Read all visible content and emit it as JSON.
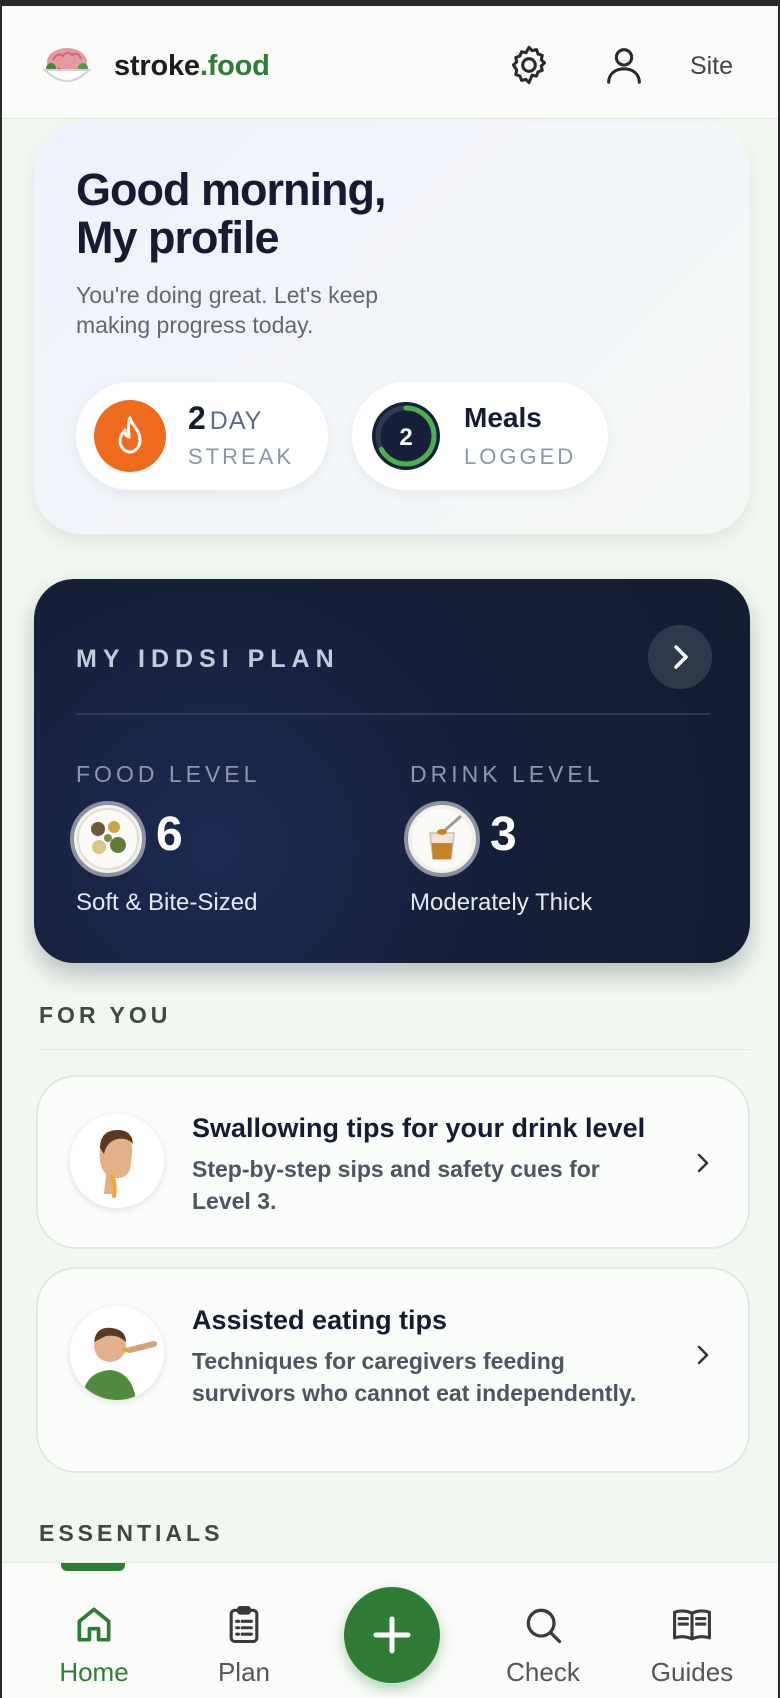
{
  "header": {
    "brand_name": "stroke",
    "brand_tld": ".food",
    "settings_icon": "gear-icon",
    "profile_icon": "user-icon",
    "site_label": "Site"
  },
  "greeting": {
    "title_line1": "Good morning,",
    "title_line2": "My profile",
    "subtitle": "You're doing great. Let's keep making progress today.",
    "streak": {
      "value": "2",
      "unit": "DAY",
      "label": "STREAK"
    },
    "meals": {
      "value": "2",
      "title": "Meals",
      "label": "LOGGED",
      "progress": 0.67
    }
  },
  "iddsi": {
    "title": "MY IDDSI PLAN",
    "food": {
      "heading": "FOOD LEVEL",
      "level": "6",
      "description": "Soft & Bite-Sized"
    },
    "drink": {
      "heading": "DRINK LEVEL",
      "level": "3",
      "description": "Moderately Thick"
    }
  },
  "for_you": {
    "heading": "FOR YOU",
    "tips": [
      {
        "title": "Swallowing tips for your drink level",
        "text": "Step-by-step sips and safety cues for Level 3."
      },
      {
        "title": "Assisted eating tips",
        "text": "Techniques for caregivers feeding survivors who cannot eat independently."
      }
    ]
  },
  "essentials": {
    "heading": "ESSENTIALS"
  },
  "nav": {
    "items": [
      {
        "label": "Home",
        "icon": "home-icon",
        "active": true
      },
      {
        "label": "Plan",
        "icon": "clipboard-icon",
        "active": false
      },
      {
        "label": "Check",
        "icon": "search-icon",
        "active": false
      },
      {
        "label": "Guides",
        "icon": "book-icon",
        "active": false
      }
    ],
    "add_icon": "plus-icon"
  },
  "colors": {
    "brand_green": "#2f7d35",
    "streak_orange": "#ee6b1d",
    "iddsi_navy": "#141e30",
    "page_bg": "#f1f8f1"
  }
}
